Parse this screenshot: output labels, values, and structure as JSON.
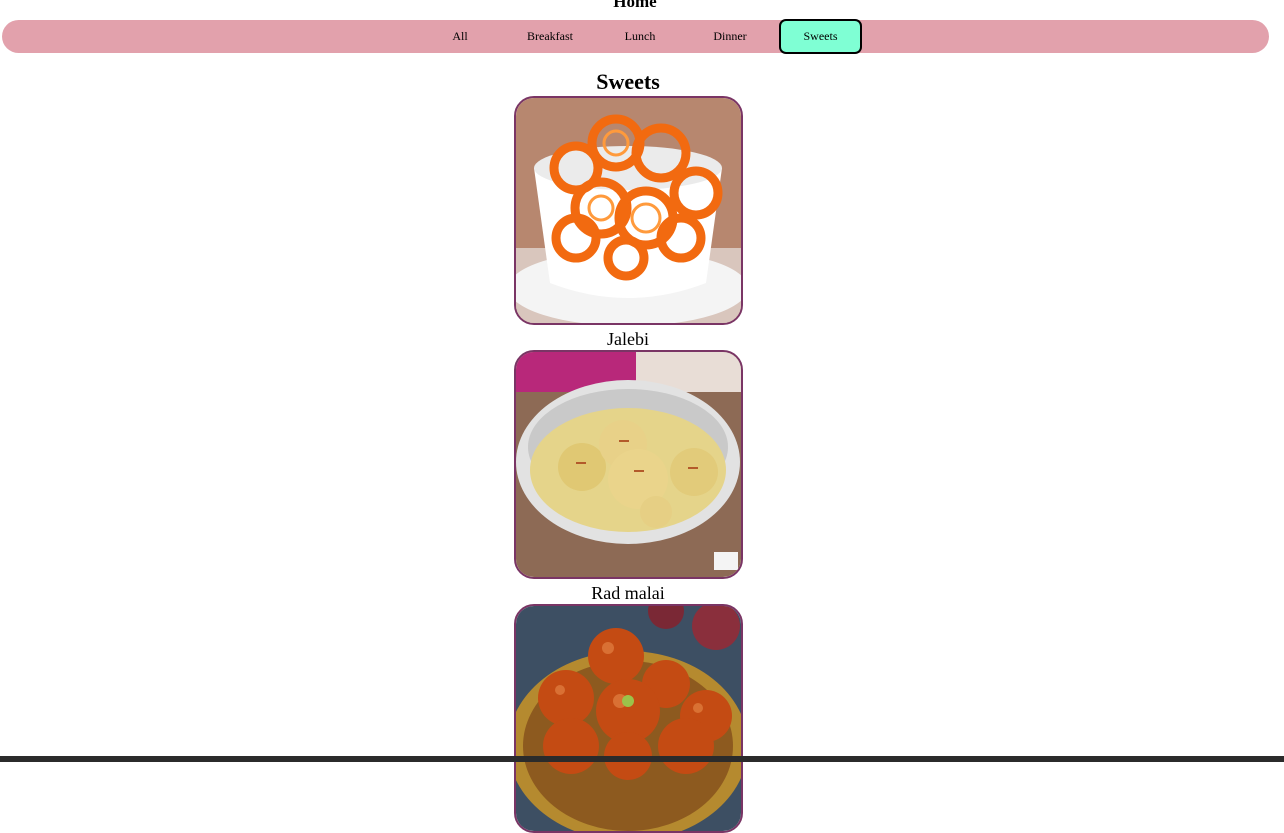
{
  "page": {
    "title": "Home"
  },
  "nav": {
    "items": [
      {
        "label": "All"
      },
      {
        "label": "Breakfast"
      },
      {
        "label": "Lunch"
      },
      {
        "label": "Dinner"
      },
      {
        "label": "Sweets"
      }
    ],
    "active": "Sweets",
    "colors": {
      "bar": "#e2a1ac",
      "active": "#7fffd4"
    }
  },
  "section": {
    "title": "Sweets"
  },
  "items": [
    {
      "name": "Jalebi"
    },
    {
      "name": "Rad malai"
    },
    {
      "name": ""
    }
  ]
}
